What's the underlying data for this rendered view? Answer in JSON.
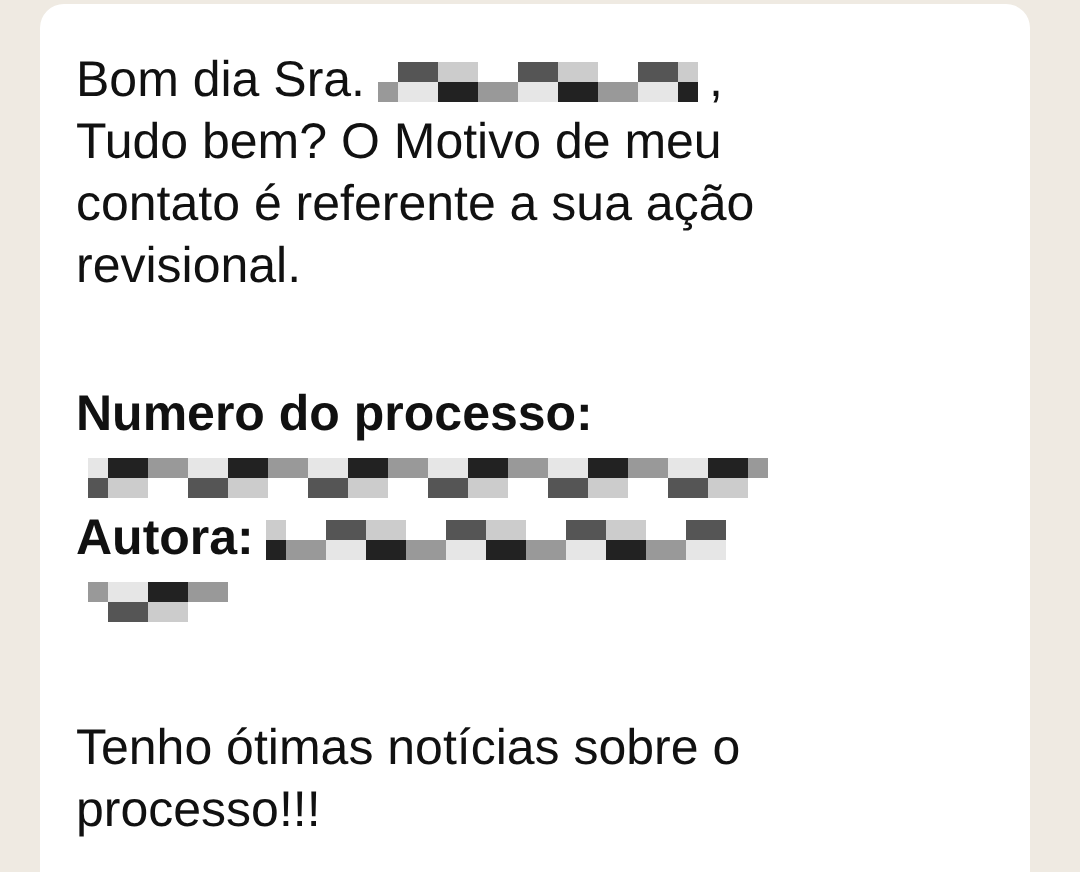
{
  "message": {
    "paragraphs": [
      {
        "lines": [
          [
            {
              "kind": "text",
              "text": "Bom dia Sra."
            },
            {
              "kind": "redacted"
            },
            {
              "kind": "text",
              "text": ","
            }
          ],
          [
            {
              "kind": "text",
              "text": "Tudo bem? O Motivo de meu"
            }
          ],
          [
            {
              "kind": "text",
              "text": "contato é referente a sua ação"
            }
          ],
          [
            {
              "kind": "text",
              "text": "revisional."
            }
          ]
        ]
      },
      {
        "lines": [
          [
            {
              "kind": "label",
              "text": "Numero do processo:"
            }
          ],
          [
            {
              "kind": "redacted"
            }
          ],
          [
            {
              "kind": "label",
              "text": "Autora:"
            },
            {
              "kind": "redacted"
            }
          ],
          [
            {
              "kind": "redacted"
            }
          ]
        ]
      },
      {
        "lines": [
          [
            {
              "kind": "text",
              "text": "Tenho ótimas notícias sobre o"
            }
          ],
          [
            {
              "kind": "text",
              "text": "processo!!!"
            }
          ]
        ]
      }
    ]
  }
}
